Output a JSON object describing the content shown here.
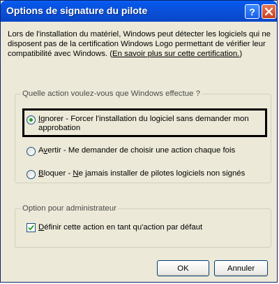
{
  "window": {
    "title": "Options de signature du pilote",
    "help_label": "?"
  },
  "description": {
    "text": "Lors de l'installation du matériel, Windows peut détecter les logiciels qui ne disposent pas de la certification Windows Logo permettant de vérifier leur compatibilité avec Windows. (",
    "link": "En savoir plus sur cette certification.",
    "suffix": ")"
  },
  "action_group": {
    "legend": "Quelle action voulez-vous que Windows effectue ?",
    "options": [
      {
        "accel": "I",
        "rest": "gnorer - Forcer l'installation du logiciel sans demander mon approbation",
        "selected": true
      },
      {
        "pre": "A",
        "accel": "v",
        "rest": "ertir - Me demander de choisir une action chaque fois",
        "selected": false
      },
      {
        "accel": "B",
        "mid": "loquer - ",
        "accel2": "N",
        "rest": "e jamais installer de pilotes logiciels non signés",
        "selected": false
      }
    ]
  },
  "admin_group": {
    "legend": "Option pour administrateur",
    "checkbox_accel": "D",
    "checkbox_rest": "éfinir cette action en tant qu'action par défaut",
    "checked": true
  },
  "buttons": {
    "ok": "OK",
    "cancel": "Annuler"
  },
  "colors": {
    "titlebar": "#0b4fd6",
    "dialog_bg": "#ece9d8",
    "radio_dot": "#21a121"
  }
}
